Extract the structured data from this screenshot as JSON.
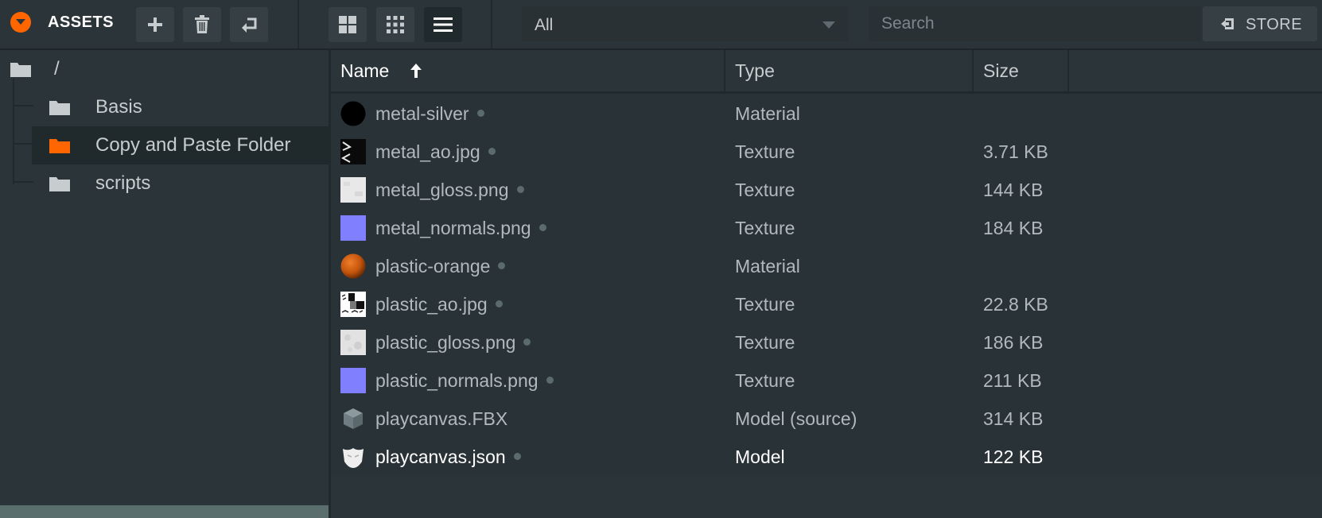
{
  "toolbar": {
    "title": "ASSETS",
    "view_filter": "All",
    "search_placeholder": "Search",
    "store_label": "STORE",
    "icons": [
      "collapse-icon",
      "add-icon",
      "trash-icon",
      "return-icon",
      "grid-large-icon",
      "grid-small-icon",
      "list-icon",
      "store-icon"
    ],
    "active_view": "list"
  },
  "tree": {
    "root": "/",
    "items": [
      {
        "label": "Basis",
        "color": "#c7ccce"
      },
      {
        "label": "Copy and Paste Folder",
        "color": "#ff6600",
        "selected": true
      },
      {
        "label": "scripts",
        "color": "#c7ccce"
      }
    ]
  },
  "table": {
    "columns": [
      "Name",
      "Type",
      "Size"
    ],
    "sort": {
      "column": "Name",
      "direction": "ascending"
    },
    "rows": [
      {
        "name": "metal-silver",
        "type": "Material",
        "size": "",
        "thumb": "black-sphere"
      },
      {
        "name": "metal_ao.jpg",
        "type": "Texture",
        "size": "3.71 KB",
        "thumb": "ao-texture"
      },
      {
        "name": "metal_gloss.png",
        "type": "Texture",
        "size": "144 KB",
        "thumb": "gloss-texture"
      },
      {
        "name": "metal_normals.png",
        "type": "Texture",
        "size": "184 KB",
        "thumb": "normal-texture"
      },
      {
        "name": "plastic-orange",
        "type": "Material",
        "size": "",
        "thumb": "orange-sphere"
      },
      {
        "name": "plastic_ao.jpg",
        "type": "Texture",
        "size": "22.8 KB",
        "thumb": "ao-texture-checker"
      },
      {
        "name": "plastic_gloss.png",
        "type": "Texture",
        "size": "186 KB",
        "thumb": "gloss-texture"
      },
      {
        "name": "plastic_normals.png",
        "type": "Texture",
        "size": "211 KB",
        "thumb": "normal-texture"
      },
      {
        "name": "playcanvas.FBX",
        "type": "Model (source)",
        "size": "314 KB",
        "thumb": "cube-icon"
      },
      {
        "name": "playcanvas.json",
        "type": "Model",
        "size": "122 KB",
        "thumb": "model-icon",
        "selected": true
      }
    ]
  },
  "colors": {
    "accent": "#ff6600",
    "background": "#2b3438",
    "panel_dark": "#20292b",
    "normal_map": "#8080ff"
  }
}
